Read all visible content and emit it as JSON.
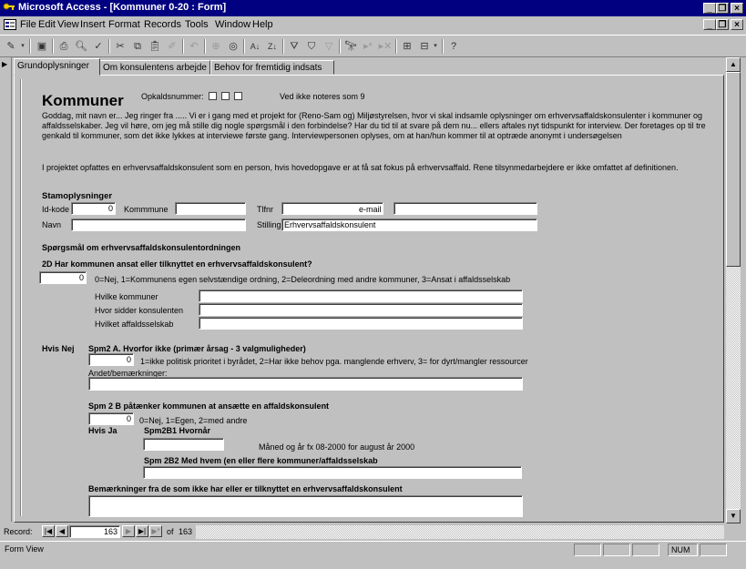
{
  "window": {
    "title": "Microsoft Access - [Kommuner 0-20 : Form]"
  },
  "menu": [
    "File",
    "Edit",
    "View",
    "Insert",
    "Format",
    "Records",
    "Tools",
    "Window",
    "Help"
  ],
  "tabs": [
    "Grundoplysninger",
    "Om konsulentens arbejde",
    "Behov for fremtidig indsats"
  ],
  "form": {
    "title": "Kommuner",
    "opkald_label": "Opkaldsnummer:",
    "opkald_note": "Ved ikke noteres som 9",
    "intro": "Goddag, mit navn er... Jeg ringer fra ..... Vi er i gang med et projekt for (Reno-Sam og) Miljøstyrelsen, hvor vi skal indsamle oplysninger om erhvervsaffaldskonsulenter i kommuner og affaldsselskaber. Jeg vil høre, om jeg må stille dig nogle spørgsmål i den forbindelse? Har du tid til at svare på dem nu... ellers aftales nyt tidspunkt for interview. Der foretages op til tre genkald til kommuner, som det ikke lykkes at interviewe første gang. Interviewpersonen oplyses, om at han/hun kommer til at optræde anonymt i undersøgelsen",
    "definition": "I projektet opfattes en erhvervsaffaldskonsulent som en person, hvis hovedopgave er at få sat fokus på erhvervsaffald. Rene tilsynmedarbejdere er ikke omfattet af definitionen.",
    "stam_heading": "Stamoplysninger",
    "idkode_label": "Id-kode",
    "idkode_value": "0",
    "kommune_label": "Kommmune",
    "tlf_label": "Tlfnr",
    "email_label": "e-mail",
    "navn_label": "Navn",
    "stilling_label": "Stilling",
    "stilling_value": "Erhvervsaffaldskonsulent",
    "ordning_heading": "Spørgsmål om erhvervsaffaldskonsulentordningen",
    "q2d": "2D Har kommunen ansat eller tilknyttet en erhvervsaffaldskonsulent?",
    "q2d_value": "0",
    "q2d_options": "0=Nej, 1=Kommunens egen selvstændige ordning, 2=Deleordning med andre kommuner, 3=Ansat i affaldsselskab",
    "hvilke_kommuner": "Hvilke kommuner",
    "hvor_sidder": "Hvor sidder konsulenten",
    "hvilket_selskab": "Hvilket affaldsselskab",
    "hvis_nej": "Hvis Nej",
    "spm2a": "Spm2 A. Hvorfor ikke (primær årsag - 3 valgmuligheder)",
    "spm2a_value": "0",
    "spm2a_options": "1=ikke politisk prioritet i byrådet, 2=Har ikke behov pga. manglende erhverv, 3= for dyrt/mangler ressourcer",
    "andet": "Andet/bemærkninger:",
    "spm2b": "Spm 2 B påtænker kommunen at ansætte en affaldskonsulent",
    "spm2b_value": "0",
    "spm2b_options": "0=Nej, 1=Egen, 2=med andre",
    "hvis_ja": "Hvis Ja",
    "spm2b1": "Spm2B1 Hvornår",
    "spm2b1_note": "Måned og år fx 08-2000 for august år 2000",
    "spm2b2": "Spm 2B2 Med hvem (en eller flere kommuner/affaldsselskab",
    "bemaerk": "Bemærkninger fra de som ikke har eller er tilknyttet en erhvervsaffaldskonsulent"
  },
  "navigation": {
    "record_label": "Record:",
    "current": "163",
    "of_label": "of",
    "total": "163"
  },
  "status": {
    "left": "Form View",
    "num": "NUM"
  }
}
